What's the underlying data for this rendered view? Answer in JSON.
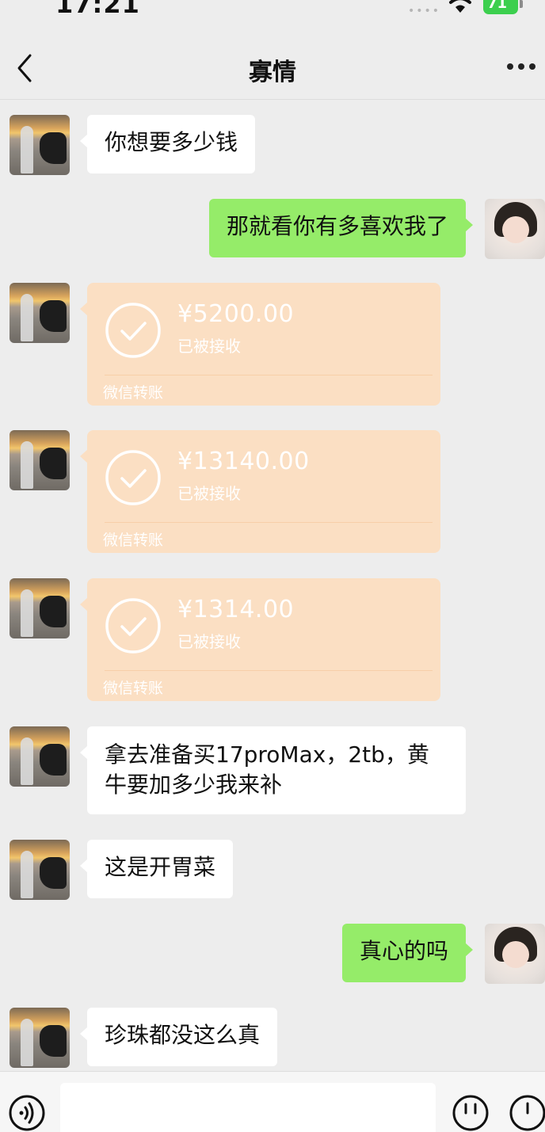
{
  "status": {
    "time": "17:21",
    "battery": "71"
  },
  "header": {
    "title": "寡情"
  },
  "messages": [
    {
      "side": "in",
      "text": "你想要多少钱"
    },
    {
      "side": "out",
      "text": "那就看你有多喜欢我了"
    },
    {
      "side": "in",
      "type": "transfer",
      "amount": "¥5200.00",
      "status": "已被接收",
      "label": "微信转账"
    },
    {
      "side": "in",
      "type": "transfer",
      "amount": "¥13140.00",
      "status": "已被接收",
      "label": "微信转账"
    },
    {
      "side": "in",
      "type": "transfer",
      "amount": "¥1314.00",
      "status": "已被接收",
      "label": "微信转账"
    },
    {
      "side": "in",
      "text_line1": "拿去准备买17proMax，2tb，黄",
      "text_line2": "牛要加多少我来补"
    },
    {
      "side": "in",
      "text": "这是开胃菜"
    },
    {
      "side": "out",
      "text": "真心的吗"
    },
    {
      "side": "in",
      "text": "珍珠都没这么真"
    }
  ],
  "colors": {
    "background": "#ededed",
    "outgoing_bubble": "#95ec69",
    "incoming_bubble": "#ffffff",
    "transfer_card": "#fbdfc3"
  },
  "icons": [
    "back-icon",
    "more-icon",
    "voice-icon",
    "emoji-icon",
    "plus-icon",
    "wifi-icon",
    "check-icon"
  ]
}
